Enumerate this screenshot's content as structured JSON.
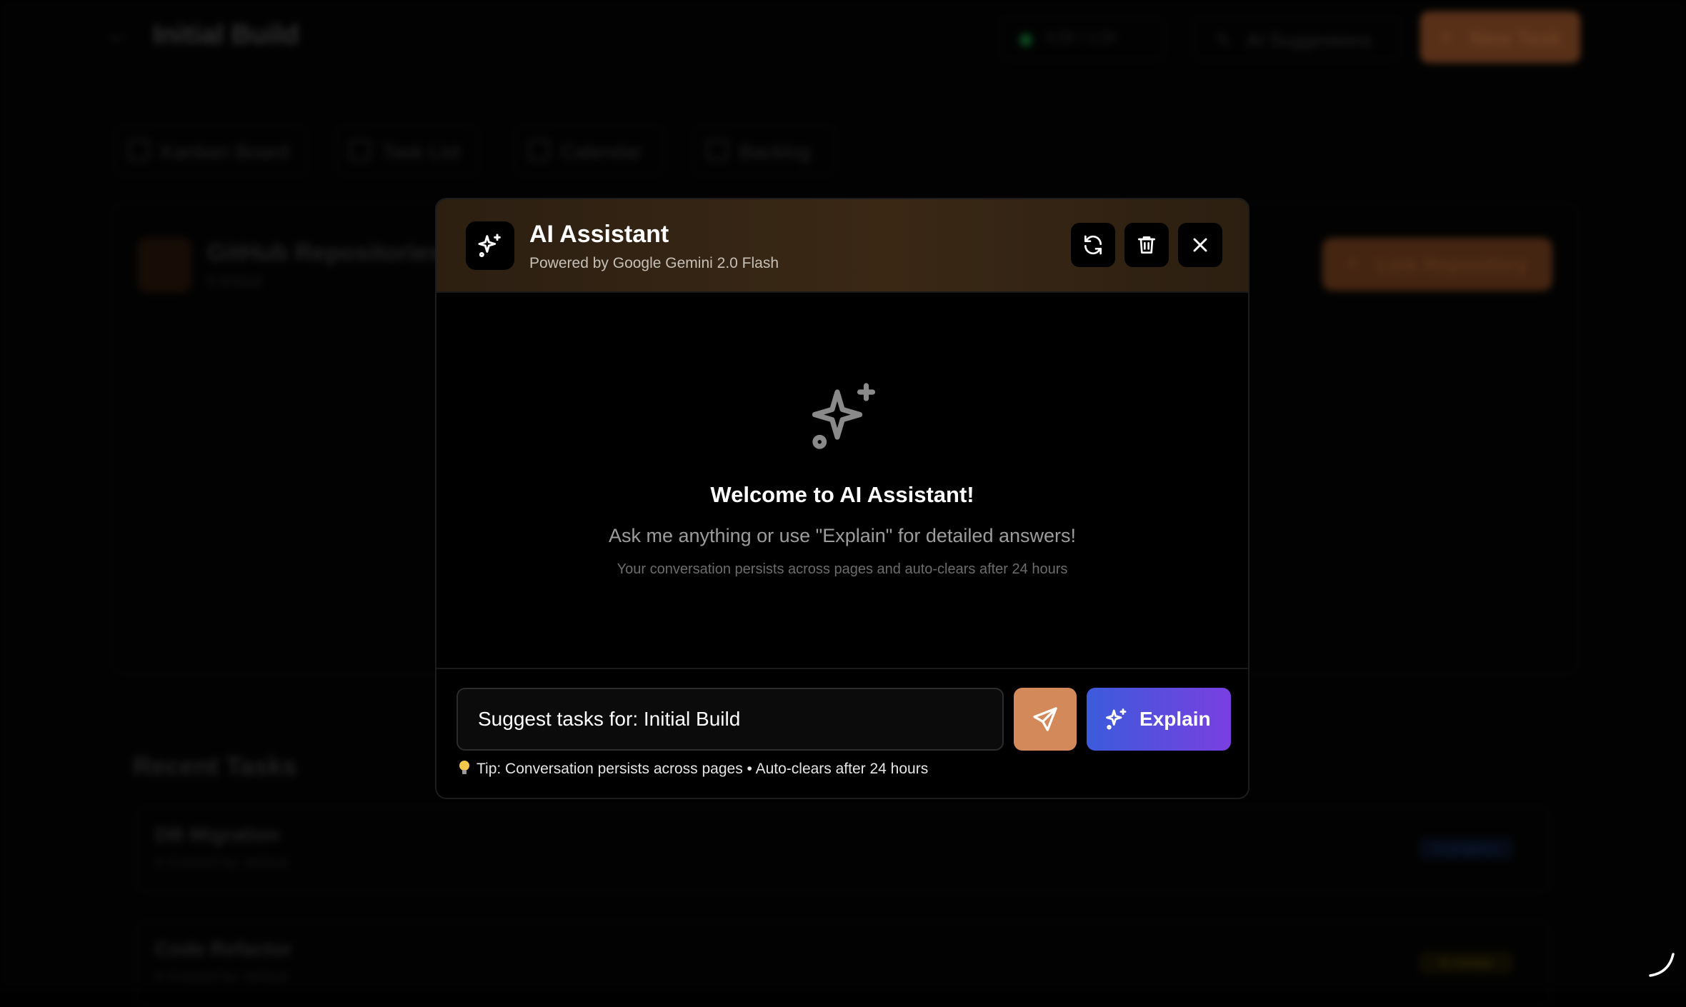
{
  "background_page": {
    "title": "Initial Build",
    "stats_text": "0.0K / 1.0K",
    "ai_suggestions_label": "AI Suggestions",
    "new_task_label": "New Task",
    "tabs": [
      "Kanban Board",
      "Task List",
      "Calendar",
      "Backlog"
    ],
    "github": {
      "title": "GitHub Repositories",
      "subtitle": "0 linked",
      "link_button": "Link Repository"
    },
    "recent_tasks_title": "Recent Tasks",
    "tasks": [
      {
        "name": "DB Migration",
        "meta": "0 Created by: default",
        "badge": "In progress"
      },
      {
        "name": "Code Refactor",
        "meta": "0 Created by: default",
        "badge": "In review"
      }
    ]
  },
  "modal": {
    "title": "AI Assistant",
    "subtitle": "Powered by Google Gemini 2.0 Flash",
    "header_buttons": {
      "refresh_icon": "refresh-icon",
      "delete_icon": "trash-icon",
      "close_icon": "close-icon"
    },
    "welcome": {
      "title": "Welcome to AI Assistant!",
      "subtitle": "Ask me anything or use \"Explain\" for detailed answers!",
      "note": "Your conversation persists across pages and auto-clears after 24 hours"
    },
    "input": {
      "value": "Suggest tasks for: Initial Build",
      "placeholder": ""
    },
    "explain_label": "Explain",
    "tip": "Tip: Conversation persists across pages • Auto-clears after 24 hours"
  },
  "colors": {
    "header_gradient": "#3a2815",
    "send_button": "#d4895b",
    "explain_gradient_start": "#3b5bdb",
    "explain_gradient_end": "#7a3fe0",
    "page_background": "#000000"
  }
}
